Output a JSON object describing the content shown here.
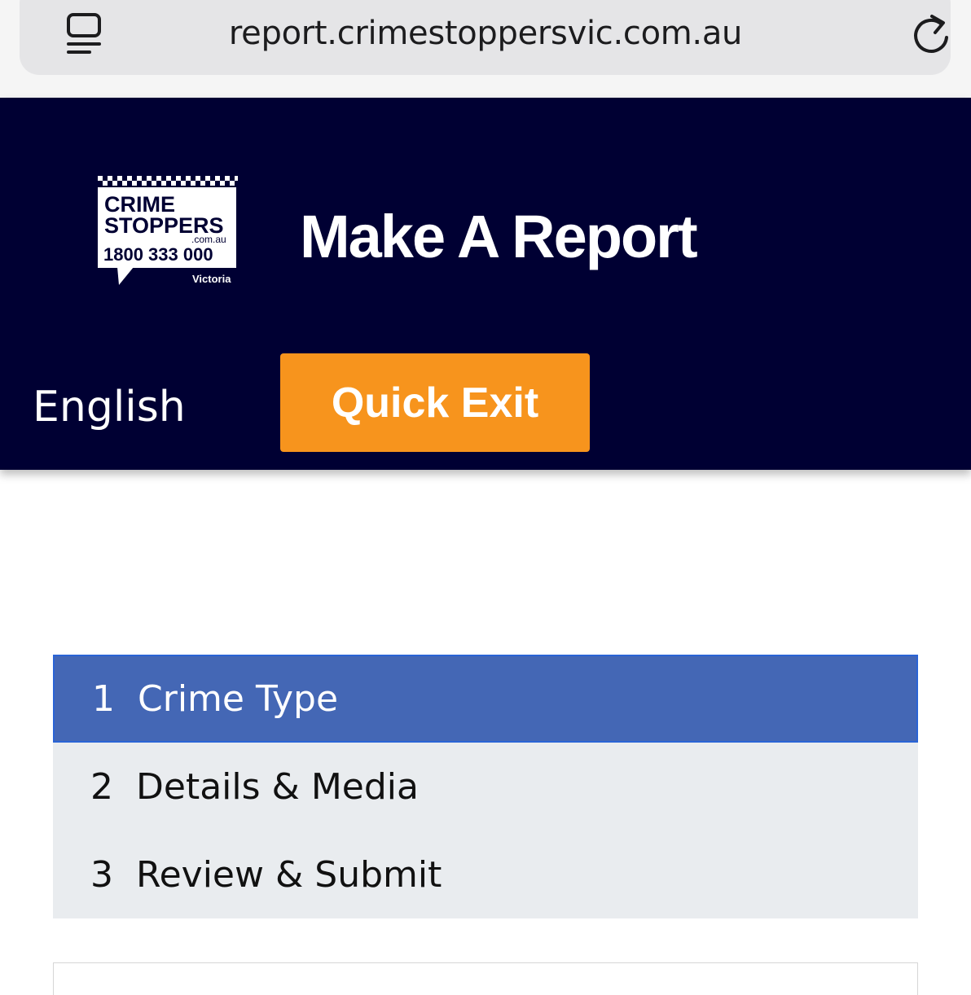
{
  "browser": {
    "url": "report.crimestoppersvic.com.au"
  },
  "header": {
    "logo": {
      "line1": "CRIME",
      "line2": "STOPPERS",
      "domain": ".com.au",
      "phone": "1800 333 000",
      "region": "Victoria"
    },
    "title": "Make A Report",
    "language": "English",
    "quick_exit_label": "Quick Exit"
  },
  "steps": [
    {
      "number": "1",
      "label": "Crime Type",
      "active": true
    },
    {
      "number": "2",
      "label": "Details & Media",
      "active": false
    },
    {
      "number": "3",
      "label": "Review & Submit",
      "active": false
    }
  ],
  "colors": {
    "header_bg": "#000033",
    "quick_exit_bg": "#f7941d",
    "active_step_bg": "#4467b5",
    "inactive_step_bg": "#e9ecef"
  },
  "icons": {
    "reader": "reader-mode-icon",
    "reload": "reload-icon"
  }
}
